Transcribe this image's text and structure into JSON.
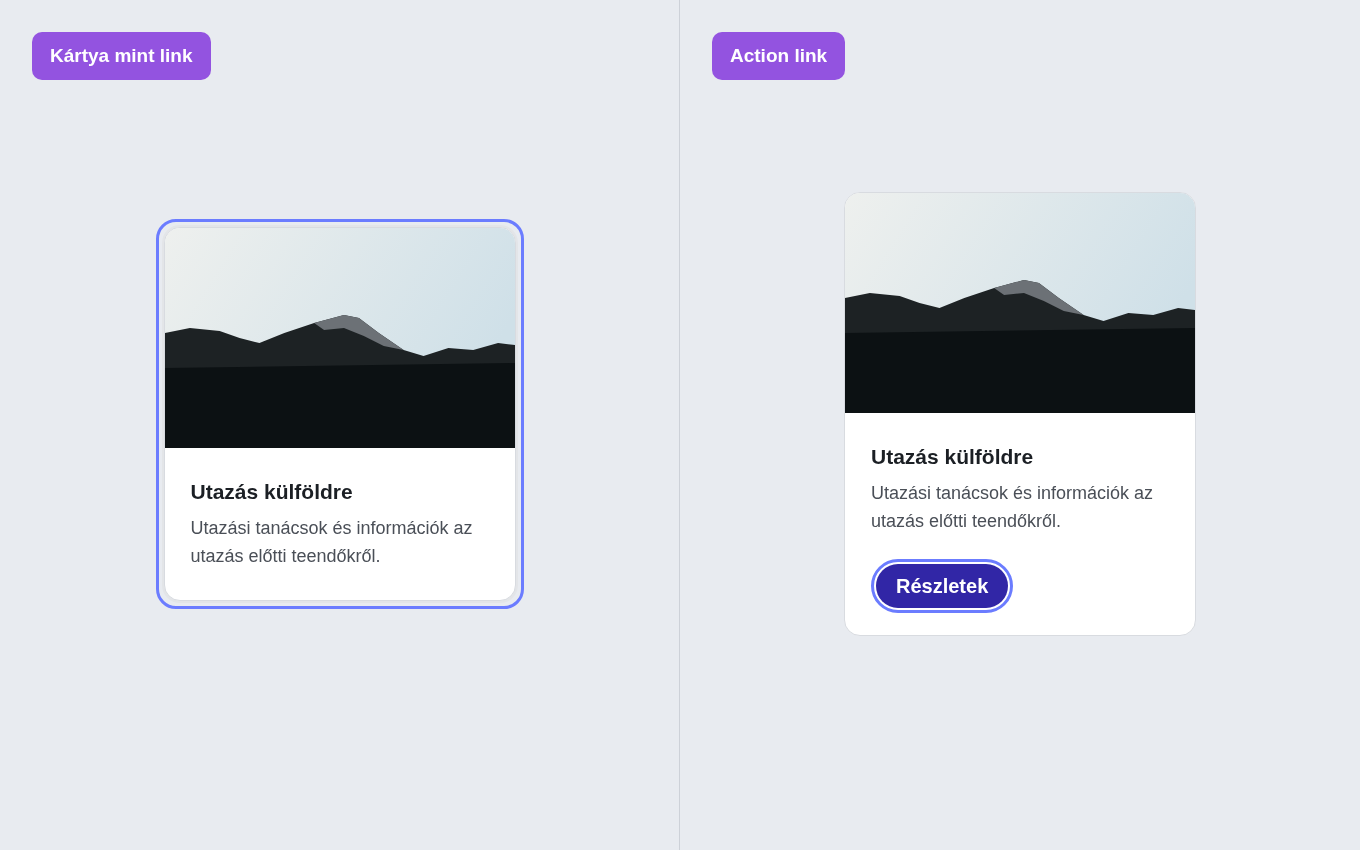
{
  "panels": [
    {
      "badge": "Kártya mint link",
      "card": {
        "focused": true,
        "title": "Utazás külföldre",
        "description": "Utazási tanácsok és információk az utazás előtti teendőkről."
      }
    },
    {
      "badge": "Action link",
      "card": {
        "focused": false,
        "title": "Utazás külföldre",
        "description": "Utazási tanácsok és információk az utazás előtti teendőkről.",
        "button": {
          "label": "Részletek",
          "focused": true
        }
      }
    }
  ]
}
